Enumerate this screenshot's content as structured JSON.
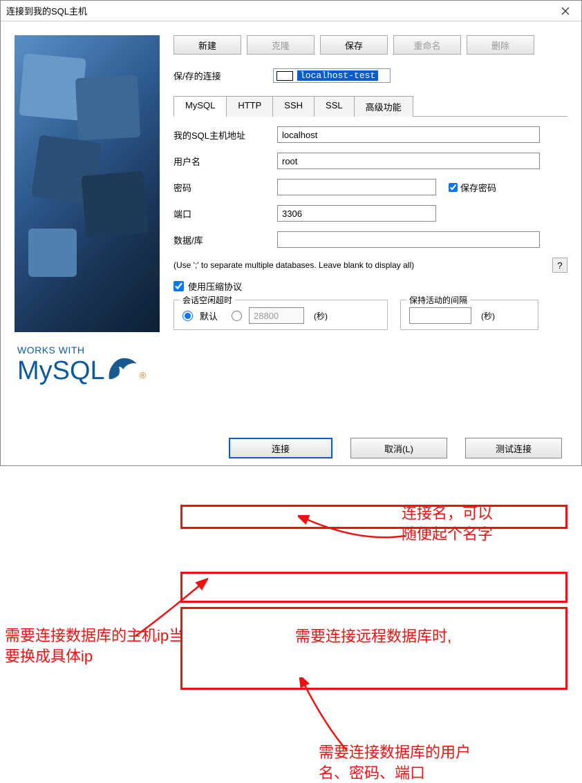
{
  "window": {
    "title": "连接到我的SQL主机"
  },
  "sidebar": {
    "works_with": "WORKS WITH",
    "mysql": "MySQL",
    "reg": "®"
  },
  "toolbar": {
    "new": "新建",
    "clone": "克隆",
    "save": "保存",
    "rename": "重命名",
    "delete": "删除"
  },
  "saved": {
    "label": "保/存的连接",
    "name": "localhost-test"
  },
  "tabs": {
    "mysql": "MySQL",
    "http": "HTTP",
    "ssh": "SSH",
    "ssl": "SSL",
    "advanced": "高级功能"
  },
  "form": {
    "host_label": "我的SQL主机地址",
    "host_value": "localhost",
    "user_label": "用户名",
    "user_value": "root",
    "pwd_label": "密码",
    "pwd_value": "",
    "save_pwd_label": "保存密码",
    "port_label": "端口",
    "port_value": "3306",
    "db_label": "数据/库",
    "db_value": "",
    "hint": "(Use ';' to separate multiple databases. Leave blank to display all)",
    "help": "?",
    "compress": "使用压缩协议",
    "idle_legend": "会话空闲超时",
    "idle_default": "默认",
    "idle_custom_value": "28800",
    "idle_unit": "(秒)",
    "keepalive_legend": "保持活动的间隔",
    "keepalive_value": "",
    "keepalive_unit": "(秒)"
  },
  "footer": {
    "connect": "连接",
    "cancel": "取消(L)",
    "test": "测试连接"
  },
  "annotations": {
    "conn_name": "连接名，可以\n随便起个名字",
    "host_ip": "需要连接数据库的主机ip当\n要换成具体ip",
    "remote": "需要连接远程数据库时,",
    "user_note": "需要连接数据库的用户\n名、密码、端口"
  }
}
